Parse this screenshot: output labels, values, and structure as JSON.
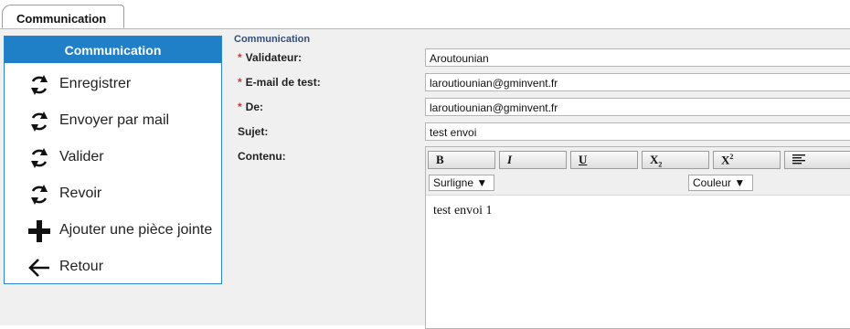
{
  "tab": {
    "label": "Communication"
  },
  "sidebar": {
    "title": "Communication",
    "items": [
      {
        "label": "Enregistrer",
        "icon": "refresh-icon"
      },
      {
        "label": "Envoyer par mail",
        "icon": "refresh-icon"
      },
      {
        "label": "Valider",
        "icon": "refresh-icon"
      },
      {
        "label": "Revoir",
        "icon": "refresh-icon"
      },
      {
        "label": "Ajouter une pièce jointe",
        "icon": "plus-icon"
      },
      {
        "label": "Retour",
        "icon": "arrow-left-icon"
      }
    ]
  },
  "form": {
    "section_title": "Communication",
    "required_mark": "*",
    "validateur": {
      "label": "Validateur:",
      "value": "Aroutounian"
    },
    "email_test": {
      "label": "E-mail de test:",
      "value": "laroutiounian@gminvent.fr"
    },
    "de": {
      "label": "De:",
      "value": "laroutiounian@gminvent.fr"
    },
    "sujet": {
      "label": "Sujet:",
      "value": "test envoi"
    },
    "contenu": {
      "label": "Contenu:"
    }
  },
  "editor": {
    "toolbar": {
      "bold": "B",
      "italic": "I",
      "underline": "U",
      "subscript": "X",
      "sub_mark": "2",
      "superscript": "X",
      "sup_mark": "2"
    },
    "surligne": "Surligne ▼",
    "couleur": "Couleur ▼",
    "body": "test envoi 1"
  },
  "colors": {
    "accent": "#1f7fc7",
    "required": "#c63b3b",
    "section_title": "#324e7c"
  }
}
